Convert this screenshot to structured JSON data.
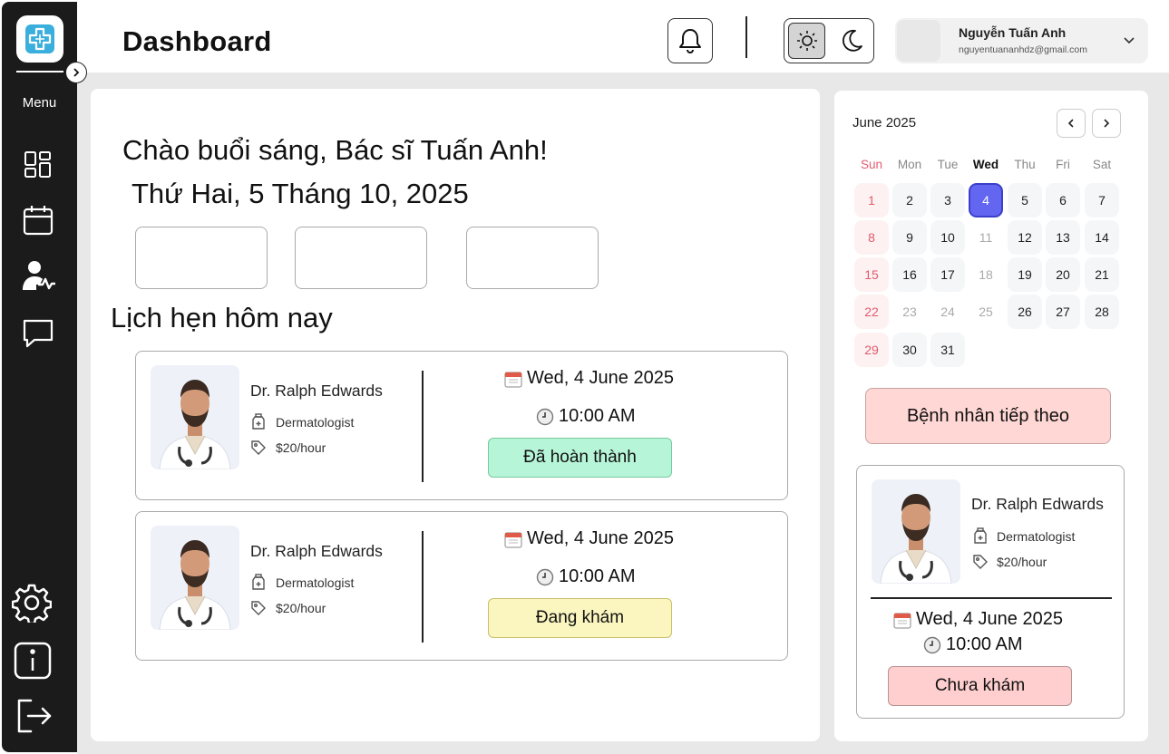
{
  "header": {
    "title": "Dashboard",
    "user_name": "Nguyễn Tuấn Anh",
    "user_email": "nguyentuananhdz@gmail.com"
  },
  "sidebar": {
    "menu_label": "Menu",
    "items": [
      {
        "icon": "dashboard-icon"
      },
      {
        "icon": "calendar-icon"
      },
      {
        "icon": "patient-monitor-icon"
      },
      {
        "icon": "chat-icon"
      },
      {
        "icon": "settings-icon"
      },
      {
        "icon": "info-icon"
      },
      {
        "icon": "logout-icon"
      }
    ]
  },
  "main": {
    "greeting": "Chào buổi sáng, Bác sĩ Tuấn Anh!",
    "date": "Thứ Hai, 5 Tháng 10, 2025",
    "section_title": "Lịch hẹn hôm nay",
    "appointments": [
      {
        "doctor": "Dr. Ralph Edwards",
        "specialty": "Dermatologist",
        "price": "$20/hour",
        "date": "Wed, 4 June 2025",
        "time": "10:00 AM",
        "status": "Đã hoàn thành",
        "status_color": "#b7f5d8"
      },
      {
        "doctor": "Dr. Ralph Edwards",
        "specialty": "Dermatologist",
        "price": "$20/hour",
        "date": "Wed, 4 June 2025",
        "time": "10:00 AM",
        "status": "Đang khám",
        "status_color": "#fbf6bf"
      }
    ]
  },
  "calendar": {
    "month": "June 2025",
    "weekdays": [
      "Sun",
      "Mon",
      "Tue",
      "Wed",
      "Thu",
      "Fri",
      "Sat"
    ],
    "selected_day": "4",
    "weeks": [
      [
        "1",
        "2",
        "3",
        "4",
        "5",
        "6",
        "7"
      ],
      [
        "8",
        "9",
        "10",
        "11",
        "12",
        "13",
        "14"
      ],
      [
        "15",
        "16",
        "17",
        "18",
        "19",
        "20",
        "21"
      ],
      [
        "22",
        "23",
        "24",
        "25",
        "26",
        "27",
        "28"
      ],
      [
        "29",
        "30",
        "31"
      ]
    ],
    "muted_days": [
      "11",
      "18",
      "23",
      "24",
      "25"
    ]
  },
  "next_patient": {
    "button_label": "Bệnh nhân tiếp theo",
    "doctor": "Dr. Ralph Edwards",
    "specialty": "Dermatologist",
    "price": "$20/hour",
    "date": "Wed, 4 June 2025",
    "time": "10:00 AM",
    "status": "Chưa khám"
  },
  "colors": {
    "sidebar": "#1b1b1b",
    "accent": "#6366f1",
    "completed": "#b7f5d8",
    "in_progress": "#fbf6bf",
    "pending": "#ffcfcf",
    "next_button": "#ffd7d4"
  }
}
